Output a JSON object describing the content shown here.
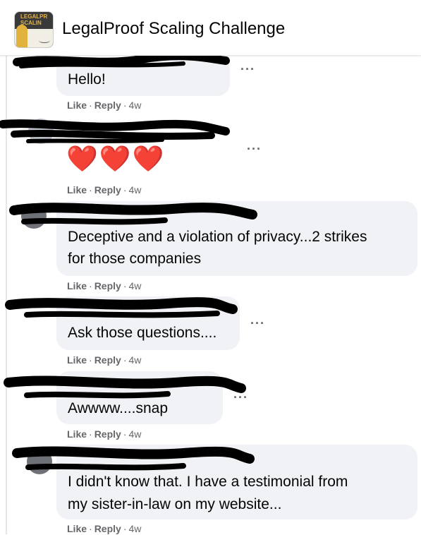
{
  "group": {
    "title": "LegalProof Scaling Challenge",
    "avatar_text": "LEGALPR SCALIN"
  },
  "comments": [
    {
      "text": "Hello!",
      "like": "Like",
      "reply": "Reply",
      "time": "4w"
    },
    {
      "text": "❤️❤️❤️",
      "like": "Like",
      "reply": "Reply",
      "time": "4w"
    },
    {
      "text_line1": "Deceptive and a violation of privacy...2 strikes",
      "text_line2": "for those companies",
      "like": "Like",
      "reply": "Reply",
      "time": "4w"
    },
    {
      "text": "Ask those questions....",
      "like": "Like",
      "reply": "Reply",
      "time": "4w"
    },
    {
      "text": "Awwww....snap",
      "like": "Like",
      "reply": "Reply",
      "time": "4w"
    },
    {
      "text_line1": "I didn't know that. I have a testimonial from",
      "text_line2": "my sister-in-law on my website...",
      "like": "Like",
      "reply": "Reply",
      "time": "4w"
    }
  ],
  "ui": {
    "more_glyph": "···",
    "dot_sep": "·"
  },
  "colors": {
    "bubble": "#f0f2f5",
    "meta_text": "#65676b",
    "redaction": "#000000",
    "heart": "#e0102a"
  },
  "icons": {
    "more": "more-options-icon",
    "redaction": "redaction-scribble"
  }
}
